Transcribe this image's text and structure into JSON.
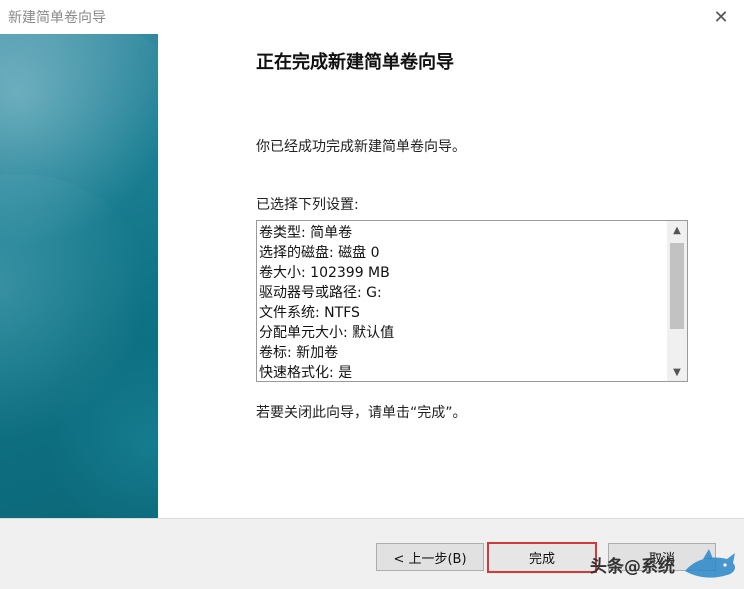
{
  "window": {
    "title": "新建简单卷向导",
    "close_glyph": "✕"
  },
  "content": {
    "heading": "正在完成新建简单卷向导",
    "description": "你已经成功完成新建简单卷向导。",
    "settings_label": "已选择下列设置:",
    "settings": [
      "卷类型: 简单卷",
      "选择的磁盘: 磁盘 0",
      "卷大小: 102399 MB",
      "驱动器号或路径: G:",
      "文件系统: NTFS",
      "分配单元大小: 默认值",
      "卷标: 新加卷",
      "快速格式化: 是"
    ],
    "close_hint": "若要关闭此向导，请单击“完成”。"
  },
  "scrollbar": {
    "up_glyph": "▲",
    "down_glyph": "▼"
  },
  "footer": {
    "back_label": "< 上一步(B)",
    "finish_label": "完成",
    "cancel_label": "取消"
  },
  "watermark": {
    "text": "头条@系统"
  },
  "colors": {
    "side_panel": "#0f7385",
    "finish_highlight": "#d23a3a"
  }
}
